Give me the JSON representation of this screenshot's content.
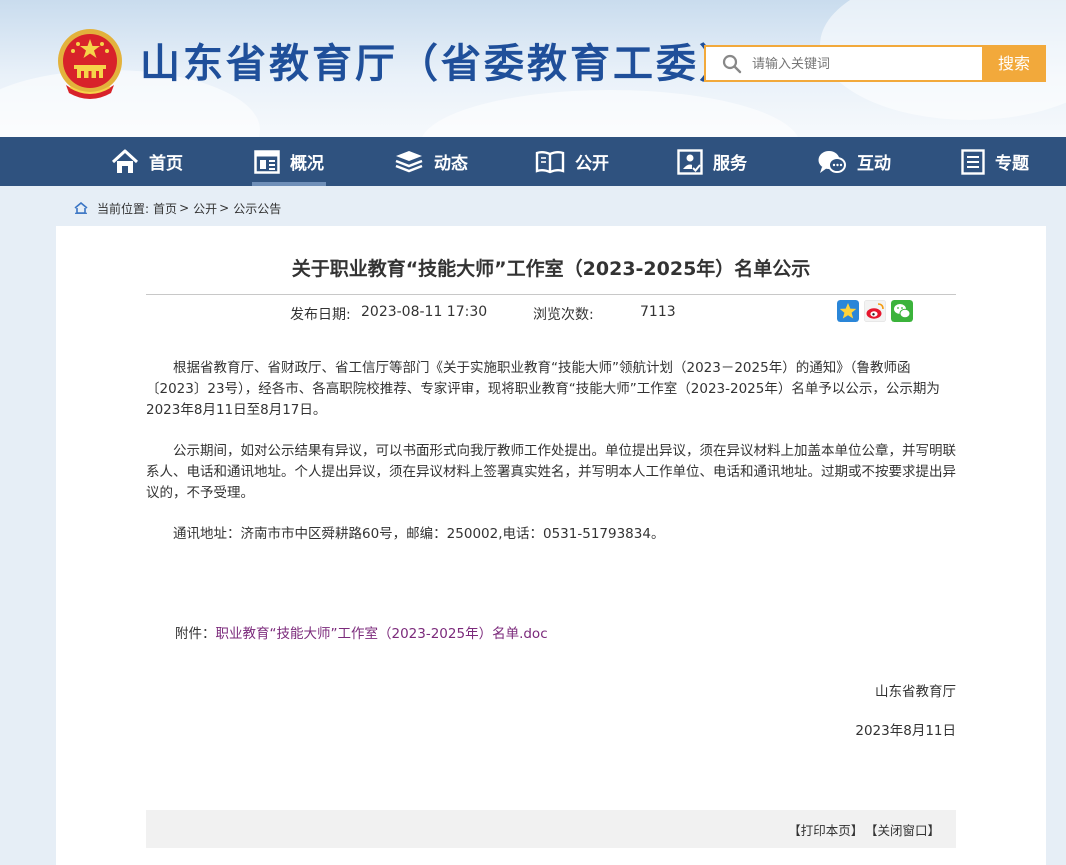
{
  "header": {
    "site_title": "山东省教育厅（省委教育工委）",
    "search_placeholder": "请输入关键词",
    "search_button": "搜索"
  },
  "nav": [
    {
      "label": "首页",
      "icon": "home-icon"
    },
    {
      "label": "概况",
      "icon": "overview-icon"
    },
    {
      "label": "动态",
      "icon": "news-icon"
    },
    {
      "label": "公开",
      "icon": "book-icon"
    },
    {
      "label": "服务",
      "icon": "service-icon"
    },
    {
      "label": "互动",
      "icon": "chat-icon"
    },
    {
      "label": "专题",
      "icon": "topic-icon"
    }
  ],
  "breadcrumb": {
    "prefix": "当前位置:",
    "items": [
      "首页",
      "公开",
      "公示公告"
    ],
    "separator": ">"
  },
  "article": {
    "title": "关于职业教育“技能大师”工作室（2023-2025年）名单公示",
    "date_label": "发布日期:",
    "date_value": "2023-08-11 17:30",
    "views_label": "浏览次数:",
    "views_value": "7113",
    "paragraphs": [
      "根据省教育厅、省财政厅、省工信厅等部门《关于实施职业教育“技能大师”领航计划（2023－2025年）的通知》（鲁教师函〔2023〕23号），经各市、各高职院校推荐、专家评审，现将职业教育“技能大师”工作室（2023-2025年）名单予以公示，公示期为2023年8月11日至8月17日。",
      "公示期间，如对公示结果有异议，可以书面形式向我厅教师工作处提出。单位提出异议，须在异议材料上加盖本单位公章，并写明联系人、电话和通讯地址。个人提出异议，须在异议材料上签署真实姓名，并写明本人工作单位、电话和通讯地址。过期或不按要求提出异议的，不予受理。",
      "通讯地址：济南市市中区舜耕路60号，邮编：250002,电话：0531-51793834。"
    ],
    "attachment_label": "附件：",
    "attachment_link": "职业教育“技能大师”工作室（2023-2025年）名单.doc",
    "signature": "山东省教育厅",
    "sign_date": "2023年8月11日"
  },
  "footer": {
    "print": "【打印本页】",
    "close": "【关闭窗口】"
  },
  "colors": {
    "nav_bg": "#2f527f",
    "title_blue": "#1f4f9a",
    "accent_orange": "#f2a93b",
    "link_purple": "#7b2a7b"
  }
}
